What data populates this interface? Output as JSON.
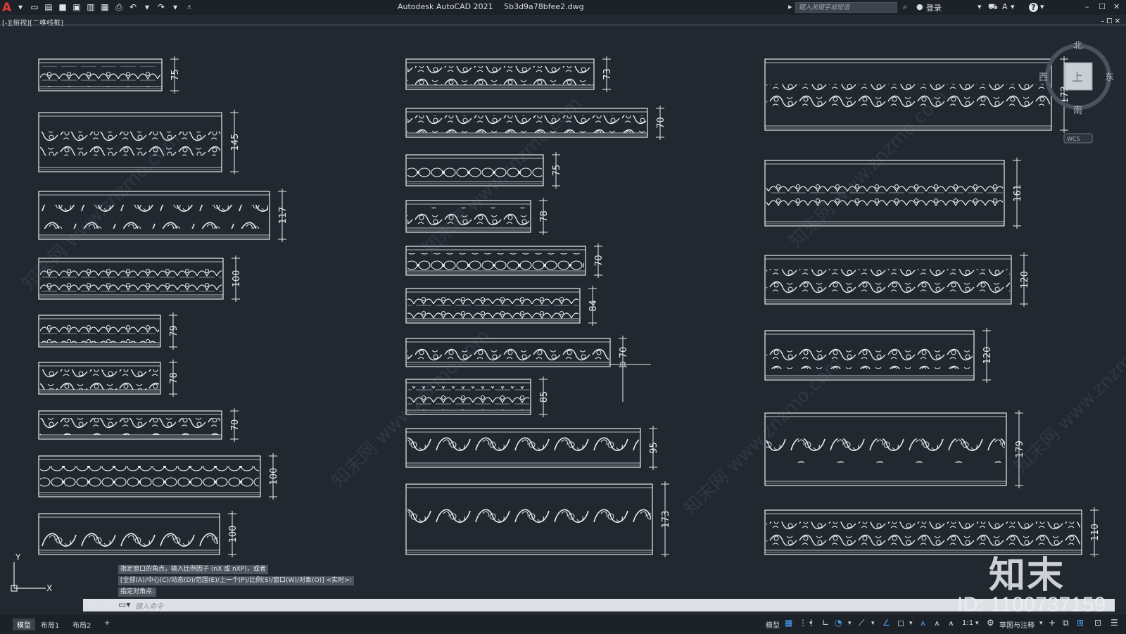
{
  "titlebar": {
    "app_name": "Autodesk AutoCAD 2021",
    "file_name": "5b3d9a78bfee2.dwg",
    "search_placeholder": "键入关键字或短语",
    "login_label": "登录",
    "help_label": "?"
  },
  "viewport": {
    "label": "[-][俯视][二维线框]",
    "controls": "– ⧠ ✕"
  },
  "viewcube": {
    "north": "北",
    "south": "南",
    "east": "东",
    "west": "西",
    "top_face": "上",
    "wcs": "WCS"
  },
  "ucs": {
    "y": "Y",
    "x": "X"
  },
  "drawing": {
    "col1": [
      "75",
      "145",
      "117",
      "100",
      "79",
      "78",
      "70",
      "100",
      "100"
    ],
    "col2": [
      "73",
      "70",
      "75",
      "78",
      "70",
      "84",
      "70",
      "85",
      "95",
      "173"
    ],
    "col3": [
      "173",
      "161",
      "120",
      "120",
      "179",
      "110"
    ]
  },
  "command": {
    "history": [
      "指定窗口的角点，输入比例因子 (nX 或 nXP)，或者",
      "[全部(A)/中心(C)/动态(D)/范围(E)/上一个(P)/比例(S)/窗口(W)/对象(O)] <实时>:",
      "指定对角点:"
    ],
    "placeholder": "键入命令"
  },
  "layout_tabs": [
    "模型",
    "布局1",
    "布局2",
    "+"
  ],
  "status": {
    "model_label": "模型",
    "scale": "1:1",
    "workspace": "草图与注释"
  },
  "watermark": {
    "logo": "知末",
    "id": "ID: 1100737159",
    "site": "知末网 www.znzmo.com"
  }
}
